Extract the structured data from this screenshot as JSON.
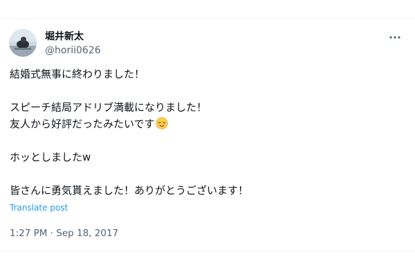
{
  "user": {
    "display_name": "堀井新太",
    "handle": "@horii0626"
  },
  "more_icon": "more-horizontal-icon",
  "tweet": {
    "lines": [
      "結婚式無事に終わりました！",
      "",
      "スピーチ結局アドリブ満載になりました！",
      "友人から好評だったみたいです",
      "",
      "ホッとしましたw",
      "",
      "皆さんに勇気貰えました！ありがとうございます！"
    ],
    "emoji": "relieved-face-emoji"
  },
  "translate_label": "Translate post",
  "timestamp": "1:27 PM · Sep 18, 2017",
  "colors": {
    "text": "#0f1419",
    "secondary": "#536471",
    "link": "#1d9bf0",
    "border": "#eff3f4"
  }
}
